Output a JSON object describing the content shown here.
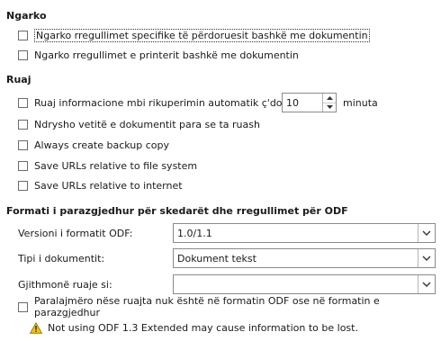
{
  "sections": {
    "ngarko": {
      "title": "Ngarko",
      "opt1": "Ngarko rregullimet specifike të përdoruesit bashkë me dokumentin",
      "opt2": "Ngarko rregullimet e printerit bashkë me dokumentin"
    },
    "ruaj": {
      "title": "Ruaj",
      "autosave_label": "Ruaj informacione mbi rikuperimin automatik ç'do:",
      "autosave_value": "10",
      "autosave_unit": "minuta",
      "opt_props": "Ndrysho vetitë e dokumentit para se ta ruash",
      "opt_backup": "Always create backup copy",
      "opt_urls_fs": "Save URLs relative to file system",
      "opt_urls_inet": "Save URLs relative to internet"
    },
    "format": {
      "title": "Formati i parazgjedhur për skedarët dhe rregullimet për ODF",
      "odf_version_label": "Versioni i formatit ODF:",
      "odf_version_value": "1.0/1.1",
      "doc_type_label": "Tipi i dokumentit:",
      "doc_type_value": "Dokument tekst",
      "always_save_label": "Gjithmonë ruaje si:",
      "always_save_value": "",
      "warn_option": "Paralajmëro nëse ruajta nuk është në formatin ODF ose në formatin e parazgjedhur",
      "warning_text": "Not using ODF 1.3 Extended may cause information to be lost."
    }
  },
  "icons": {
    "checkbox": "checkbox-unchecked",
    "dropdown": "chevron-down-icon",
    "spin_up": "spin-up-icon",
    "spin_down": "spin-down-icon",
    "warning": "warning-icon"
  },
  "colors": {
    "warning_fill": "#f5c400",
    "border": "#8a8a8a"
  }
}
